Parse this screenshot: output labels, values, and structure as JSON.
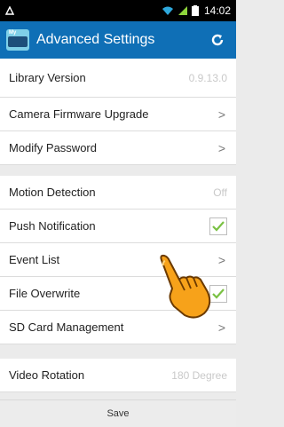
{
  "status_bar": {
    "time": "14:02",
    "colors": {
      "background": "#000000",
      "wifi": "#2ea8dc",
      "signal": "#8dd43c"
    }
  },
  "action_bar": {
    "title": "Advanced Settings",
    "app_icon": "app-logo-icon",
    "refresh_icon": "refresh-icon",
    "color": "#0f6fb6"
  },
  "settings": {
    "library_version": {
      "label": "Library Version",
      "value": "0.9.13.0"
    },
    "camera_firmware": {
      "label": "Camera Firmware Upgrade"
    },
    "modify_password": {
      "label": "Modify Password"
    },
    "motion_detection": {
      "label": "Motion Detection",
      "value": "Off"
    },
    "push_notification": {
      "label": "Push Notification",
      "checked": true
    },
    "event_list": {
      "label": "Event List"
    },
    "file_overwrite": {
      "label": "File Overwrite",
      "checked": true
    },
    "sd_card": {
      "label": "SD Card Management"
    },
    "video_rotation": {
      "label": "Video Rotation",
      "value": "180 Degree"
    }
  },
  "save_button": {
    "label": "Save"
  },
  "chevron": ">",
  "check_color": "#7ac143"
}
